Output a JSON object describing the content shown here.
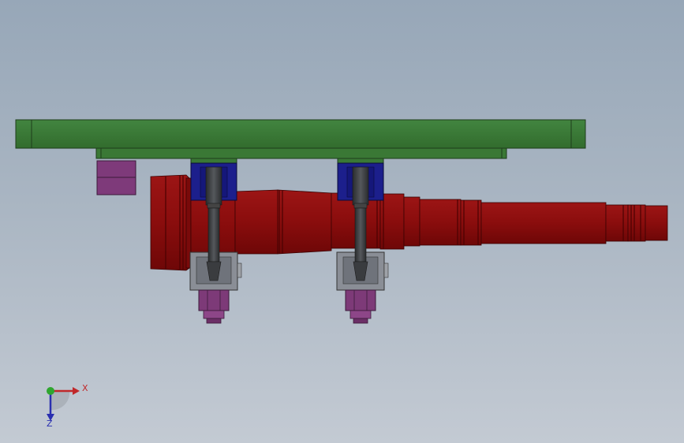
{
  "viewport": {
    "background_top": "#97a7b8",
    "background_bottom": "#c3cad3"
  },
  "colors": {
    "base_plate": "#3c7a36",
    "shaft": "#8b0f0f",
    "clamp_block": "#1c1f8c",
    "hex_nut": "#7d3a78",
    "support_block": "#8a8e96",
    "stud": "#3b3d40",
    "x_axis": "#c0282a",
    "y_axis": "#2fa62f",
    "z_axis": "#2a2fb0"
  },
  "triad": {
    "x_label": "X",
    "z_label": "Z",
    "icon": "coordinate-triad-icon"
  }
}
